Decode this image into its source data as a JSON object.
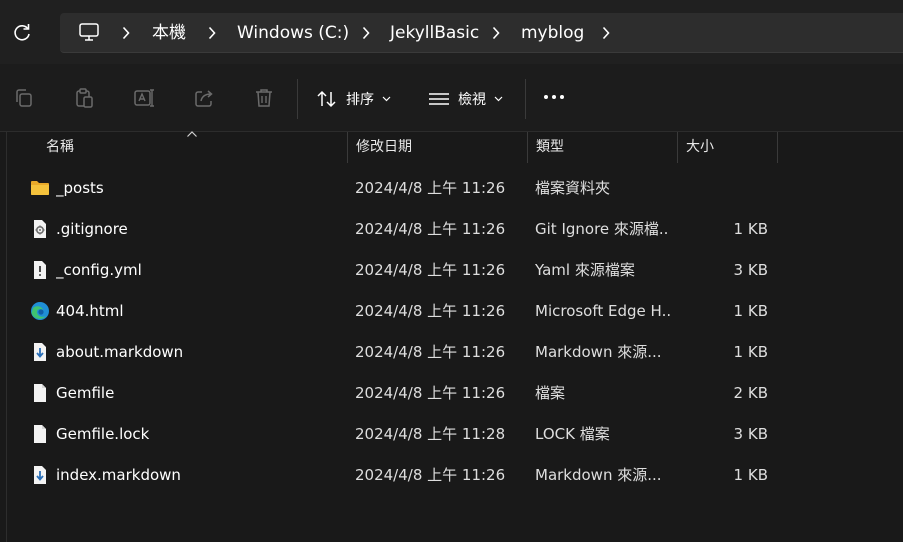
{
  "address": {
    "root_icon": "computer-icon",
    "crumbs": [
      "本機",
      "Windows (C:)",
      "JekyllBasic",
      "myblog"
    ]
  },
  "toolbar": {
    "copy_icon": "copy-icon",
    "paste_icon": "paste-icon",
    "rename_icon": "rename-icon",
    "share_icon": "share-icon",
    "delete_icon": "delete-icon",
    "sort_label": "排序",
    "view_label": "檢視",
    "more_icon": "more-icon"
  },
  "columns": {
    "name": "名稱",
    "date": "修改日期",
    "type": "類型",
    "size": "大小"
  },
  "files": [
    {
      "icon": "folder-icon",
      "name": "_posts",
      "date": "2024/4/8 上午 11:26",
      "type": "檔案資料夾",
      "size": ""
    },
    {
      "icon": "gear-file-icon",
      "name": ".gitignore",
      "date": "2024/4/8 上午 11:26",
      "type": "Git Ignore 來源檔...",
      "size": "1 KB"
    },
    {
      "icon": "warning-file-icon",
      "name": "_config.yml",
      "date": "2024/4/8 上午 11:26",
      "type": "Yaml 來源檔案",
      "size": "3 KB"
    },
    {
      "icon": "edge-icon",
      "name": "404.html",
      "date": "2024/4/8 上午 11:26",
      "type": "Microsoft Edge H...",
      "size": "1 KB"
    },
    {
      "icon": "markdown-file-icon",
      "name": "about.markdown",
      "date": "2024/4/8 上午 11:26",
      "type": "Markdown 來源...",
      "size": "1 KB"
    },
    {
      "icon": "blank-file-icon",
      "name": "Gemfile",
      "date": "2024/4/8 上午 11:26",
      "type": "檔案",
      "size": "2 KB"
    },
    {
      "icon": "blank-file-icon",
      "name": "Gemfile.lock",
      "date": "2024/4/8 上午 11:28",
      "type": "LOCK 檔案",
      "size": "3 KB"
    },
    {
      "icon": "markdown-file-icon",
      "name": "index.markdown",
      "date": "2024/4/8 上午 11:26",
      "type": "Markdown 來源...",
      "size": "1 KB"
    }
  ],
  "colors": {
    "background": "#191919",
    "address_bar": "#2d2d2d",
    "folder": "#f4c23c",
    "edge_blue": "#1f8fd6",
    "edge_green": "#3fc371"
  }
}
